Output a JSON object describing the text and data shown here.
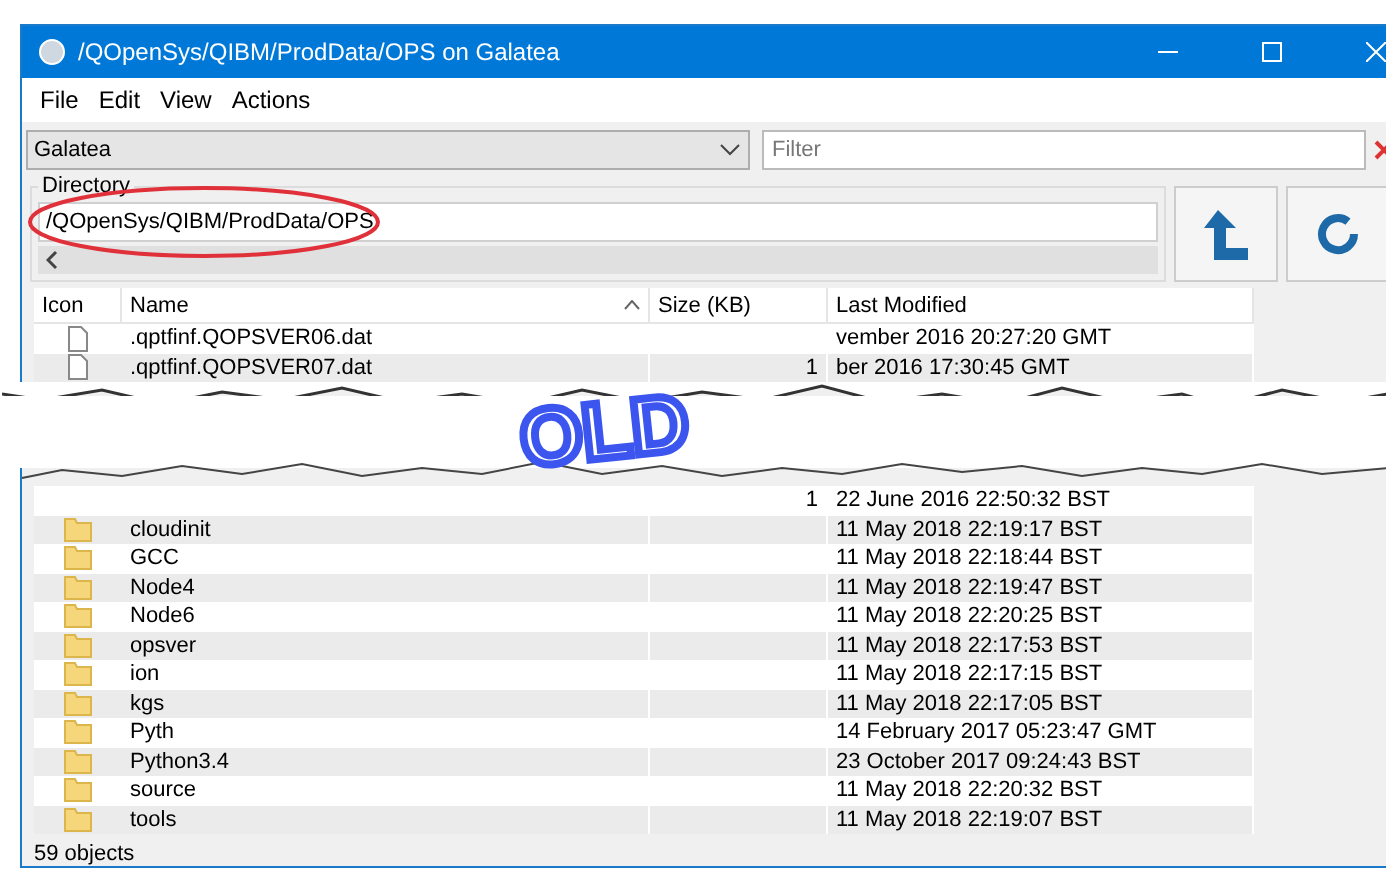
{
  "window": {
    "title": "/QOpenSys/QIBM/ProdData/OPS on Galatea"
  },
  "menu": [
    "File",
    "Edit",
    "View",
    "Actions"
  ],
  "system": {
    "value": "Galatea"
  },
  "filter": {
    "placeholder": "Filter"
  },
  "directory": {
    "label": "Directory",
    "value": "/QOpenSys/QIBM/ProdData/OPS"
  },
  "columns": [
    {
      "label": "Icon",
      "sorted": false
    },
    {
      "label": "Name",
      "sorted": true
    },
    {
      "label": "Size (KB)",
      "sorted": false
    },
    {
      "label": "Last Modified",
      "sorted": false
    }
  ],
  "rows_top": [
    {
      "kind": "file",
      "name": ".qptfinf.QOPSVER06.dat",
      "modified": "vember 2016 20:27:20 GMT"
    },
    {
      "kind": "file",
      "name": ".qptfinf.QOPSVER07.dat",
      "size": "1",
      "modified": "ber 2016 17:30:45 GMT"
    }
  ],
  "rows_bottom": [
    {
      "kind": "none",
      "size": "1",
      "modified": "22 June 2016 22:50:32 BST"
    },
    {
      "kind": "folder",
      "name": "cloudinit",
      "modified": "11 May 2018 22:19:17 BST"
    },
    {
      "kind": "folder",
      "name": "GCC",
      "modified": "11 May 2018 22:18:44 BST"
    },
    {
      "kind": "folder",
      "name": "Node4",
      "modified": "11 May 2018 22:19:47 BST"
    },
    {
      "kind": "folder",
      "name": "Node6",
      "modified": "11 May 2018 22:20:25 BST"
    },
    {
      "kind": "folder",
      "name": "opsver",
      "modified": "11 May 2018 22:17:53 BST"
    },
    {
      "kind": "folder",
      "name": "ion",
      "modified": "11 May 2018 22:17:15 BST"
    },
    {
      "kind": "folder",
      "name": "kgs",
      "modified": "11 May 2018 22:17:05 BST"
    },
    {
      "kind": "folder",
      "name": "Pyth",
      "modified": "14 February 2017 05:23:47 GMT"
    },
    {
      "kind": "folder",
      "name": "Python3.4",
      "modified": "23 October 2017 09:24:43 BST"
    },
    {
      "kind": "folder",
      "name": "source",
      "modified": "11 May 2018 22:20:32 BST"
    },
    {
      "kind": "folder",
      "name": "tools",
      "modified": "11 May 2018 22:19:07 BST"
    }
  ],
  "status": "59 objects",
  "stamp": "OLD"
}
